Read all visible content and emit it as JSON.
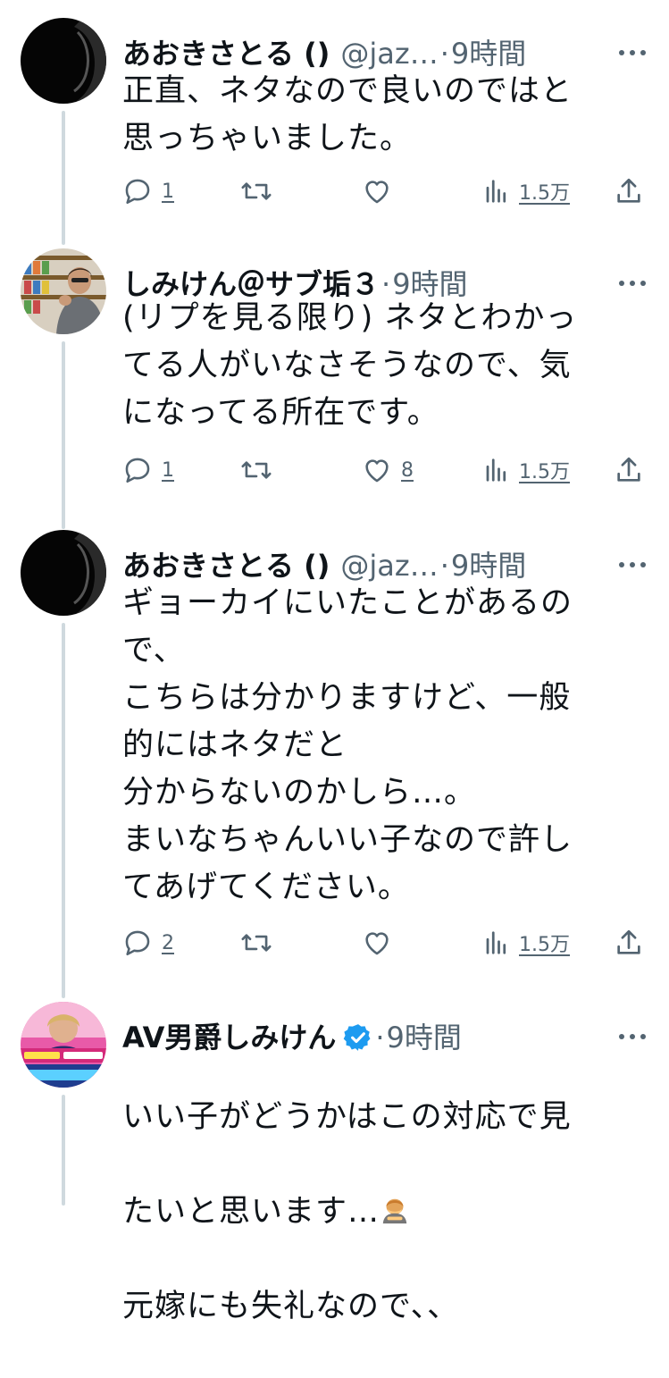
{
  "tweets": [
    {
      "name": "あおきさとる ()",
      "handle": "@jaz…",
      "dot": "·",
      "time": "9時間",
      "verified": false,
      "text": "正直、ネタなので良いのではと\n思っちゃいました。",
      "replies": "1",
      "retweets": "",
      "likes": "",
      "views": "1.5万",
      "avatar": "dark-silhouette"
    },
    {
      "name": "しみけん＠サブ垢３",
      "handle": "",
      "dot": "·",
      "time": "9時間",
      "verified": false,
      "text": "(リプを見る限り) ネタとわかっ\nてる人がいなさそうなので、気\nになってる所在です。",
      "replies": "1",
      "retweets": "",
      "likes": "8",
      "views": "1.5万",
      "avatar": "man-in-store"
    },
    {
      "name": "あおきさとる ()",
      "handle": "@jaz…",
      "dot": "·",
      "time": "9時間",
      "verified": false,
      "text": "ギョーカイにいたことがあるの\nで、\nこちらは分かりますけど、一般\n的にはネタだと\n分からないのかしら…。\nまいなちゃんいい子なので許し\nてあげてください。",
      "replies": "2",
      "retweets": "",
      "likes": "",
      "views": "1.5万",
      "avatar": "dark-silhouette"
    },
    {
      "name": "AV男爵しみけん",
      "handle": "",
      "dot": "·",
      "time": "9時間",
      "verified": true,
      "text_lines": [
        "いい子がどうかはこの対応で見",
        "たいと思います…",
        "元嫁にも失礼なので、、"
      ],
      "emoji": "bowing-person-emoji",
      "avatar": "tv-screenshot"
    }
  ],
  "colors": {
    "text": "#0f1419",
    "secondary": "#536471",
    "thread_line": "#cfd9de",
    "verified": "#1d9bf0"
  }
}
